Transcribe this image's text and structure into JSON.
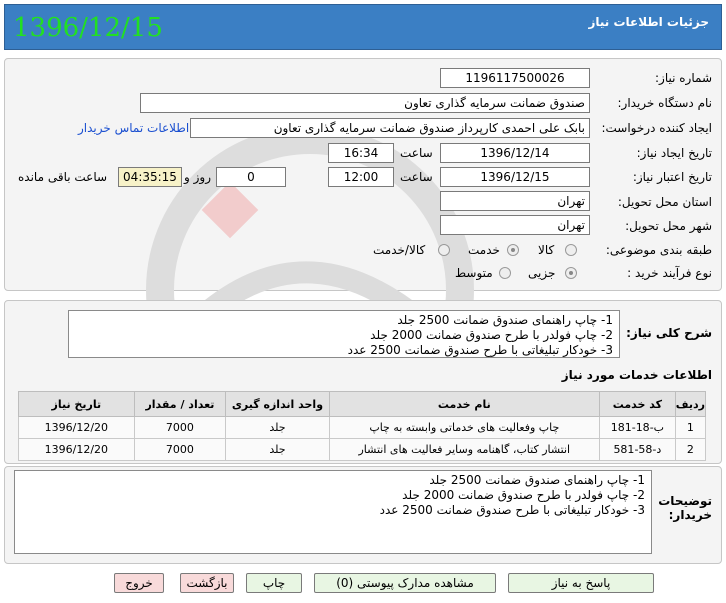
{
  "header": {
    "title": "جزئیات اطلاعات نیاز",
    "date": "1396/12/15"
  },
  "form": {
    "need_number_label": "شماره نیاز:",
    "need_number": "1196117500026",
    "buyer_org_label": "نام دستگاه خریدار:",
    "buyer_org": "صندوق ضمانت سرمایه گذاری تعاون",
    "creator_label": "ایجاد کننده درخواست:",
    "creator": "بابک علی احمدی کارپرداز صندوق ضمانت سرمایه گذاری تعاون",
    "contact_link": "اطلاعات تماس خریدار",
    "created_date_label": "تاریخ ایجاد نیاز:",
    "created_date": "1396/12/14",
    "time_label": "ساعت",
    "created_time": "16:34",
    "valid_date_label": "تاریخ اعتبار نیاز:",
    "valid_date": "1396/12/15",
    "valid_time": "12:00",
    "days": "0",
    "days_label": "روز و",
    "remaining_time": "04:35:15",
    "remaining_label": "ساعت باقی مانده",
    "province_label": "استان محل تحویل:",
    "province": "تهران",
    "city_label": "شهر محل تحویل:",
    "city": "تهران",
    "category_label": "طبقه بندی موضوعی:",
    "category_options": [
      "کالا",
      "خدمت",
      "کالا/خدمت"
    ],
    "purchase_type_label": "نوع فرآیند خرید :",
    "purchase_options": [
      "جزیی",
      "متوسط"
    ]
  },
  "summary": {
    "label": "شرح کلی نیاز:",
    "lines": [
      "1- چاپ راهنمای صندوق ضمانت 2500 جلد",
      "2- چاپ فولدر با طرح صندوق ضمانت 2000 جلد",
      "3- خودکار تبلیغاتی با طرح صندوق ضمانت 2500 عدد"
    ]
  },
  "services": {
    "heading": "اطلاعات خدمات مورد نیاز",
    "columns": [
      "ردیف",
      "کد خدمت",
      "نام خدمت",
      "واحد اندازه گیری",
      "تعداد / مقدار",
      "تاریخ نیاز"
    ],
    "rows": [
      [
        "1",
        "ب-18-181",
        "چاپ وفعالیت های خدماتی وابسته به چاپ",
        "جلد",
        "7000",
        "1396/12/20"
      ],
      [
        "2",
        "د-58-581",
        "انتشار کتاب، گاهنامه وسایر فعالیت های انتشار",
        "جلد",
        "7000",
        "1396/12/20"
      ]
    ]
  },
  "buyer_notes": {
    "label": "توضیحات خریدار:",
    "lines": [
      "1- چاپ راهنمای صندوق ضمانت 2500 جلد",
      "2- چاپ فولدر با طرح صندوق ضمانت 2000 جلد",
      "3- خودکار تبلیغاتی با طرح صندوق ضمانت 2500 عدد"
    ]
  },
  "buttons": {
    "reply": "پاسخ به نیاز",
    "attachments": "مشاهده مدارک پیوستی (0)",
    "print": "چاپ",
    "back": "بازگشت",
    "exit": "خروج"
  },
  "colors": {
    "header_bg": "#3b7fc4",
    "date_text": "#22e022",
    "link": "#1a4fd0"
  }
}
